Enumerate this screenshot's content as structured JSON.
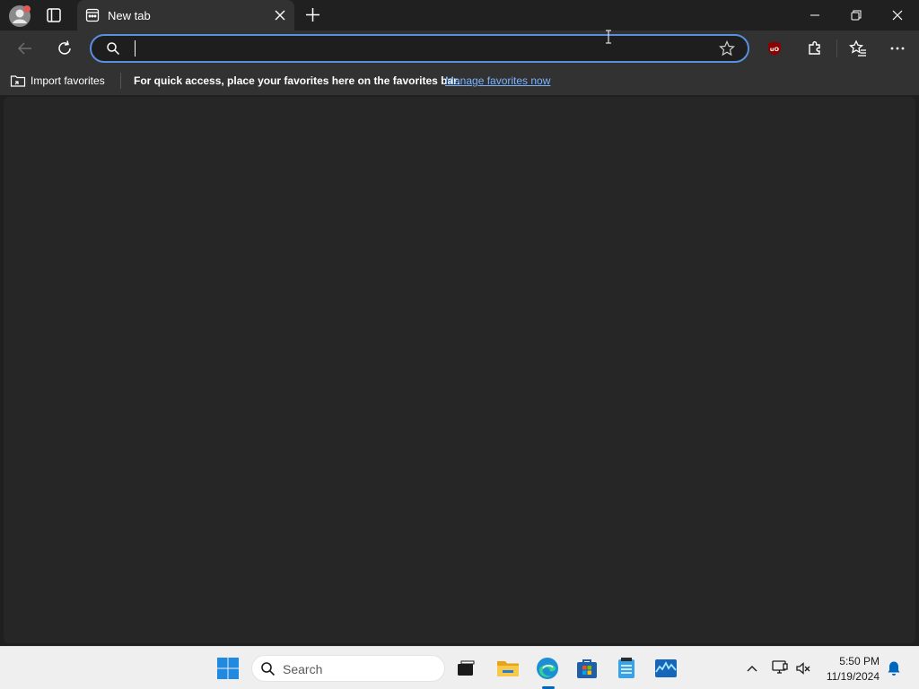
{
  "browser": {
    "tab": {
      "title": "New tab"
    },
    "omnibox": {
      "value": "",
      "placeholder": ""
    },
    "favorites_bar": {
      "import_label": "Import favorites",
      "hint": "For quick access, place your favorites here on the favorites bar.",
      "manage_link": "Manage favorites now"
    },
    "colors": {
      "accent": "#5a8fe0",
      "link": "#7bb3ff",
      "background": "#262626"
    }
  },
  "icons": {
    "profile": "profile-avatar-icon",
    "workspaces": "workspaces-icon",
    "favicon": "new-tab-favicon-icon",
    "close_tab": "close-icon",
    "new_tab": "plus-icon",
    "back": "back-arrow-icon",
    "refresh": "refresh-icon",
    "search": "search-icon",
    "favorite": "star-icon",
    "ublock": "ublock-origin-icon",
    "extensions": "puzzle-icon",
    "favorites": "favorites-icon",
    "more": "more-dots-icon"
  },
  "taskbar": {
    "search_label": "Search",
    "time": "5:50 PM",
    "date": "11/19/2024"
  }
}
